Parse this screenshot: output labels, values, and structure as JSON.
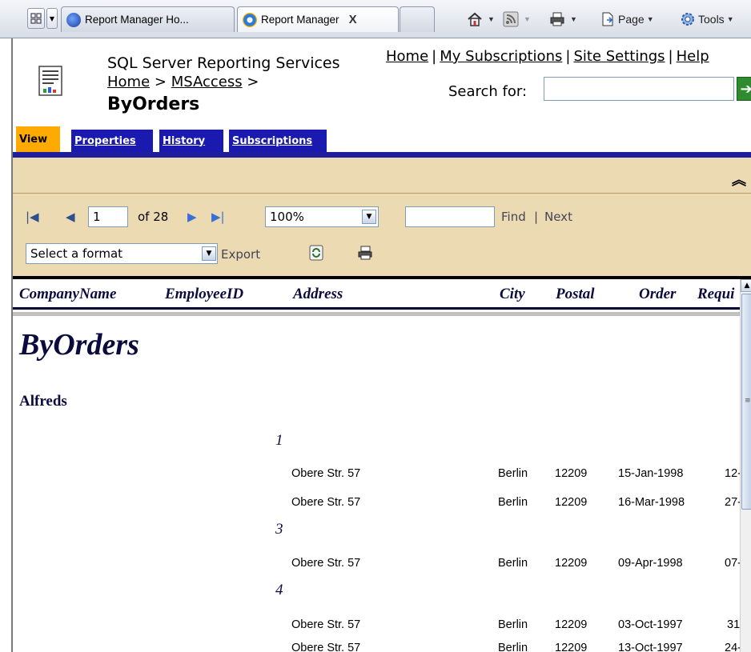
{
  "browser": {
    "tabs": [
      {
        "label": "Report Manager Ho..."
      },
      {
        "label": "Report Manager",
        "close": "X"
      }
    ],
    "toolbar": {
      "page_label": "Page",
      "tools_label": "Tools"
    }
  },
  "header": {
    "app_title": "SQL Server Reporting Services",
    "breadcrumb": {
      "home": "Home",
      "sep1": ">",
      "folder": "MSAccess",
      "sep2": ">"
    },
    "report_title": "ByOrders",
    "links": {
      "home": "Home",
      "subscriptions": "My Subscriptions",
      "settings": "Site Settings",
      "help": "Help",
      "sep": "|"
    },
    "search_label": "Search for:",
    "search_value": ""
  },
  "tabs": {
    "view": "View",
    "properties": "Properties",
    "history": "History",
    "subscriptions": "Subscriptions"
  },
  "viewer": {
    "page_value": "1",
    "page_of": "of 28",
    "zoom": "100%",
    "find_value": "",
    "find_label": "Find",
    "find_sep": "|",
    "next_label": "Next",
    "format_select": "Select a format",
    "export_label": "Export"
  },
  "columns": {
    "company": "CompanyName",
    "employee": "EmployeeID",
    "address": "Address",
    "city": "City",
    "postal": "Postal",
    "order": "Order",
    "required": "Requi"
  },
  "report": {
    "title": "ByOrders",
    "group_company": "Alfreds",
    "groups": [
      {
        "employee": "1",
        "rows": [
          {
            "address": "Obere Str. 57",
            "city": "Berlin",
            "postal": "12209",
            "order_date": "15-Jan-1998",
            "required": "12-"
          },
          {
            "address": "Obere Str. 57",
            "city": "Berlin",
            "postal": "12209",
            "order_date": "16-Mar-1998",
            "required": "27-"
          }
        ]
      },
      {
        "employee": "3",
        "rows": [
          {
            "address": "Obere Str. 57",
            "city": "Berlin",
            "postal": "12209",
            "order_date": "09-Apr-1998",
            "required": "07-"
          }
        ]
      },
      {
        "employee": "4",
        "rows": [
          {
            "address": "Obere Str. 57",
            "city": "Berlin",
            "postal": "12209",
            "order_date": "03-Oct-1997",
            "required": "31"
          },
          {
            "address": "Obere Str. 57",
            "city": "Berlin",
            "postal": "12209",
            "order_date": "13-Oct-1997",
            "required": "24-"
          }
        ]
      }
    ]
  }
}
